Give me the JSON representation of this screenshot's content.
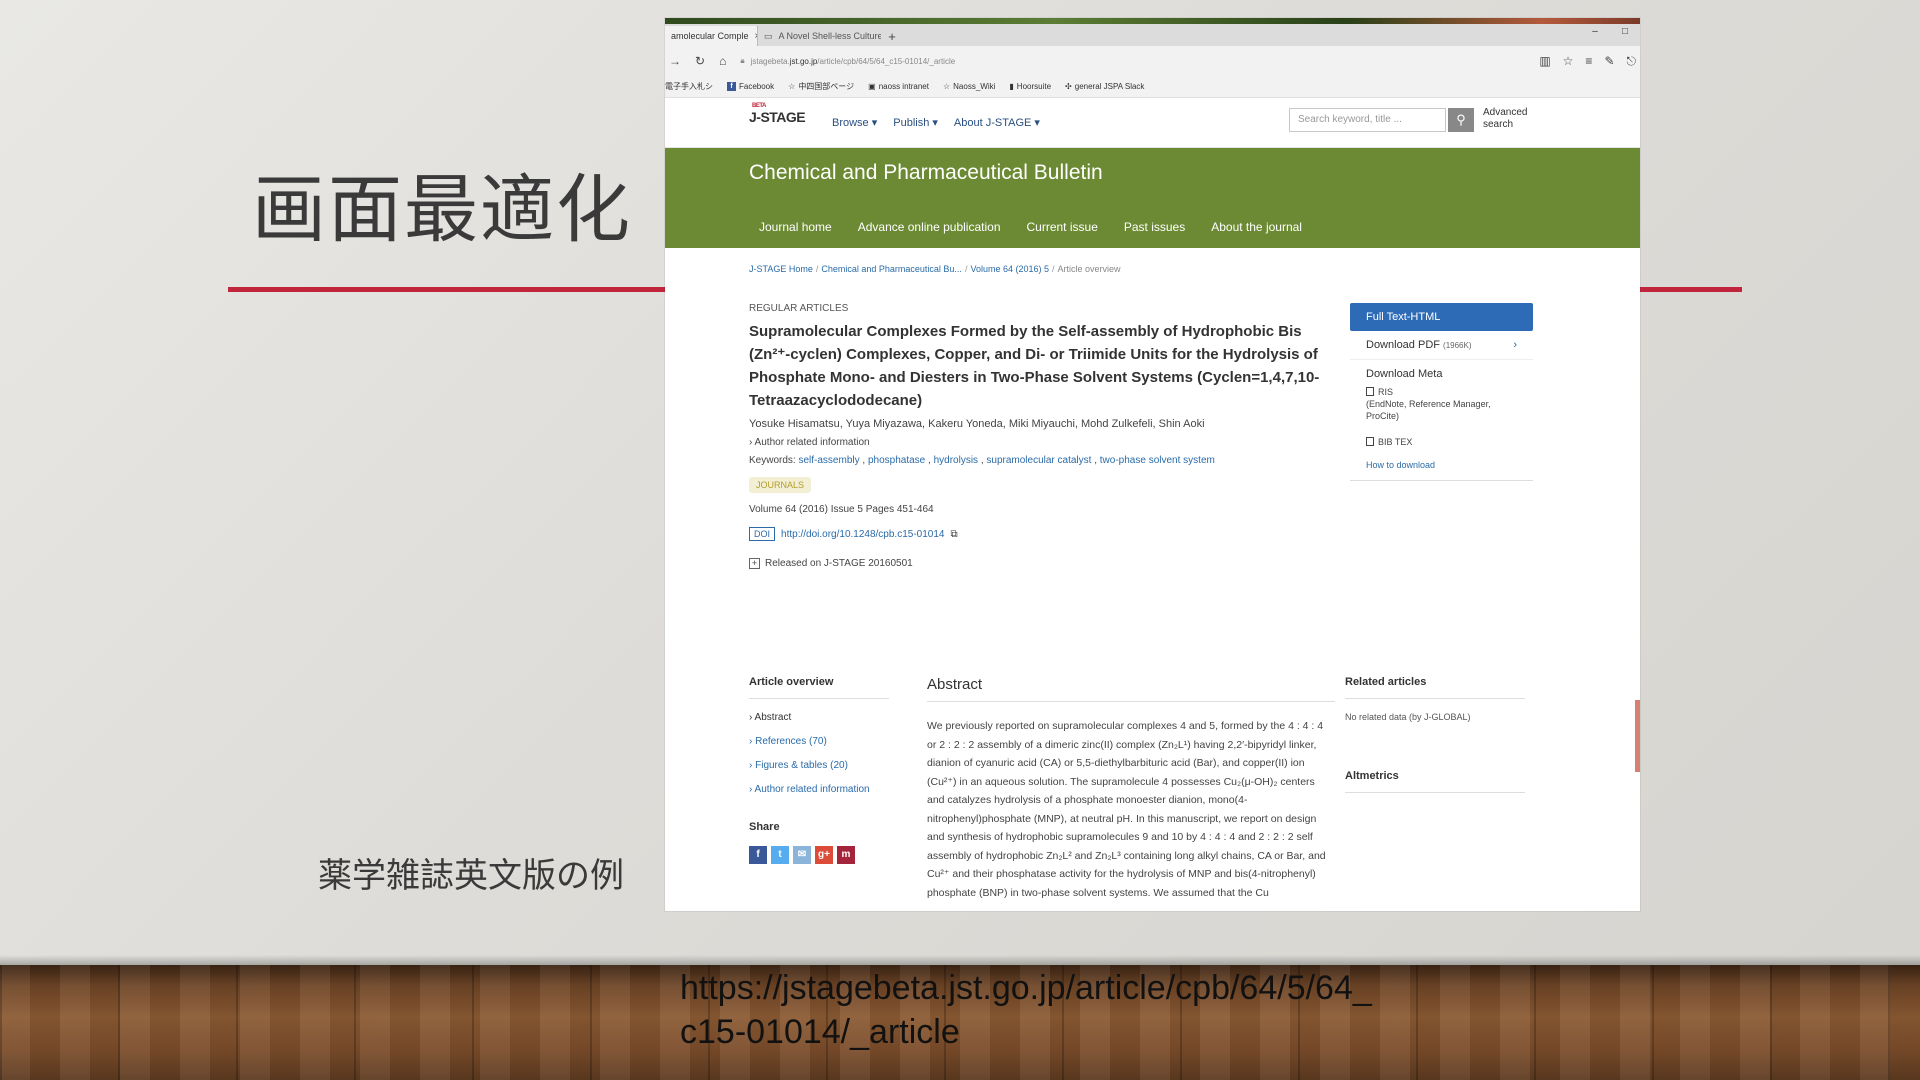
{
  "slide": {
    "title": "画面最適化",
    "caption": "薬学雑誌英文版の例",
    "url": "https://jstagebeta.jst.go.jp/article/cpb/64/5/64_c15-01014/_article"
  },
  "browser": {
    "tabs": [
      {
        "label": "amolecular Comple",
        "close": "×"
      },
      {
        "label": "A Novel Shell-less Culture S",
        "close": "×"
      }
    ],
    "new_tab": "+",
    "win_controls": [
      "–",
      "□"
    ],
    "address": {
      "prefix": "jstagebeta.",
      "domain": "jst.go.jp",
      "path": "/article/cpb/64/5/64_c15-01014/_article"
    },
    "favorites": [
      {
        "icon": "doc-icon",
        "label": "電子手入札シ"
      },
      {
        "icon": "facebook-icon",
        "label": "Facebook"
      },
      {
        "icon": "star-icon",
        "label": "中四国部ページ"
      },
      {
        "icon": "site-icon",
        "label": "naoss intranet"
      },
      {
        "icon": "star-icon",
        "label": "Naoss_Wiki"
      },
      {
        "icon": "bookmark-icon",
        "label": "Hoorsuite"
      },
      {
        "icon": "slack-icon",
        "label": "general JSPA Slack"
      }
    ]
  },
  "jstage": {
    "logo_beta": "BETA",
    "logo": "J-STAGE",
    "nav": [
      "Browse ▾",
      "Publish ▾",
      "About J-STAGE ▾"
    ],
    "search_placeholder": "Search keyword, title ...",
    "advanced": "Advanced search",
    "journal_title": "Chemical and Pharmaceutical Bulletin",
    "journal_nav": [
      "Journal home",
      "Advance online publication",
      "Current issue",
      "Past issues",
      "About the journal"
    ],
    "breadcrumbs": [
      "J-STAGE Home",
      "Chemical and Pharmaceutical Bu...",
      "Volume 64 (2016) 5",
      "Article overview"
    ],
    "article": {
      "category": "REGULAR ARTICLES",
      "title": "Supramolecular Complexes Formed by the Self-assembly of Hydrophobic Bis (Zn²⁺-cyclen) Complexes, Copper, and Di- or Triimide Units for the Hydrolysis of Phosphate Mono- and Diesters in Two-Phase Solvent Systems (Cyclen=1,4,7,10-Tetraazacyclododecane)",
      "authors": "Yosuke Hisamatsu, Yuya Miyazawa, Kakeru Yoneda, Miki Miyauchi, Mohd Zulkefeli, Shin Aoki",
      "author_info": "› Author related information",
      "keywords_label": "Keywords:",
      "keywords": [
        "self-assembly",
        "phosphatase",
        "hydrolysis",
        "supramolecular catalyst",
        "two-phase solvent system"
      ],
      "badge": "JOURNALS",
      "volume": "Volume 64 (2016) Issue 5 Pages 451-464",
      "doi_tag": "DOI",
      "doi": "http://doi.org/10.1248/cpb.c15-01014",
      "released": "Released on J-STAGE 20160501"
    },
    "sidebar": {
      "full_text": "Full Text-HTML",
      "download_pdf": "Download PDF",
      "pdf_size": "(1966K)",
      "download_meta": "Download Meta",
      "ris": "RIS",
      "ris_sub": "(EndNote, Reference Manager, ProCite)",
      "bibtex": "BIB TEX",
      "how_to": "How to download"
    },
    "overview": {
      "heading": "Article overview",
      "items": [
        "› Abstract",
        "› References (70)",
        "› Figures & tables (20)",
        "› Author related information"
      ],
      "share": "Share"
    },
    "abstract": {
      "heading": "Abstract",
      "text": "We previously reported on supramolecular complexes 4 and 5, formed by the 4 : 4 : 4 or 2 : 2 : 2 assembly of a dimeric zinc(II) complex (Zn₂L¹) having 2,2′-bipyridyl linker, dianion of cyanuric acid (CA) or 5,5-diethylbarbituric acid (Bar), and copper(II) ion (Cu²⁺) in an aqueous solution. The supramolecule 4 possesses Cu₂(μ-OH)₂ centers and catalyzes hydrolysis of a phosphate monoester dianion, mono(4-nitrophenyl)phosphate (MNP), at neutral pH. In this manuscript, we report on design and synthesis of hydrophobic supramolecules 9 and 10 by 4 : 4 : 4 and 2 : 2 : 2 self assembly of hydrophobic Zn₂L² and Zn₂L³ containing long alkyl chains, CA or Bar, and Cu²⁺ and their phosphatase activity for the hydrolysis of MNP and bis(4-nitrophenyl) phosphate (BNP) in two-phase solvent systems. We assumed that the Cu"
    },
    "related": {
      "heading": "Related articles",
      "text": "No related data (by J-GLOBAL)",
      "altmetrics": "Altmetrics"
    }
  }
}
